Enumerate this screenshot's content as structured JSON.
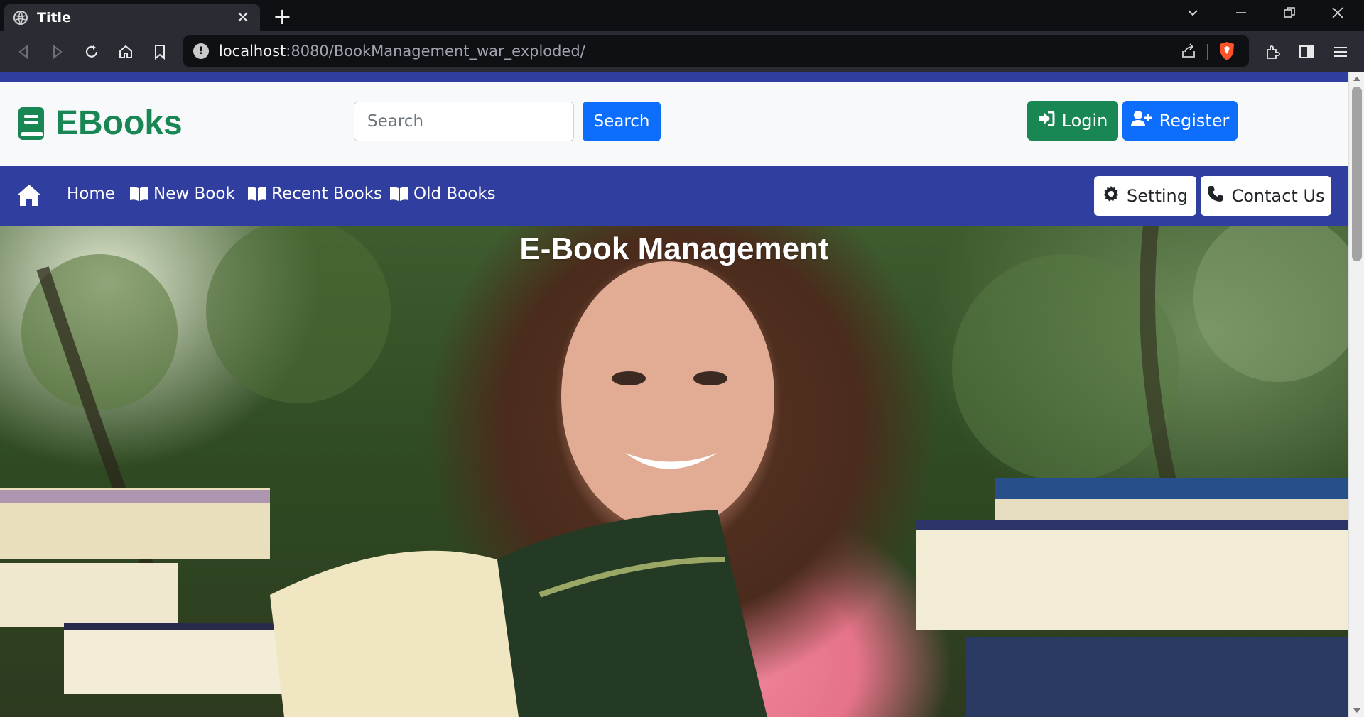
{
  "browser": {
    "tab_title": "Title",
    "url_host": "localhost",
    "url_rest": ":8080/BookManagement_war_exploded/",
    "icons": [
      "globe-icon",
      "close-icon",
      "plus-icon",
      "back-icon",
      "forward-icon",
      "reload-icon",
      "home-icon",
      "bookmark-icon",
      "info-icon",
      "share-icon",
      "brave-shield-icon",
      "extensions-icon",
      "sidebar-icon",
      "menu-icon"
    ]
  },
  "header": {
    "brand": "EBooks",
    "search_placeholder": "Search",
    "search_button": "Search",
    "login_button": "Login",
    "register_button": "Register",
    "colors": {
      "brand": "#198754",
      "primary": "#0d6efd",
      "success": "#198754",
      "strip": "#303f9f"
    }
  },
  "nav": {
    "items": [
      {
        "label": "Home",
        "icon": "home-icon"
      },
      {
        "label": "New Book",
        "icon": "open-book-icon"
      },
      {
        "label": "Recent Books",
        "icon": "open-book-icon"
      },
      {
        "label": "Old Books",
        "icon": "open-book-icon"
      }
    ],
    "setting_button": "Setting",
    "contact_button": "Contact Us"
  },
  "hero": {
    "title": "E-Book Management"
  }
}
